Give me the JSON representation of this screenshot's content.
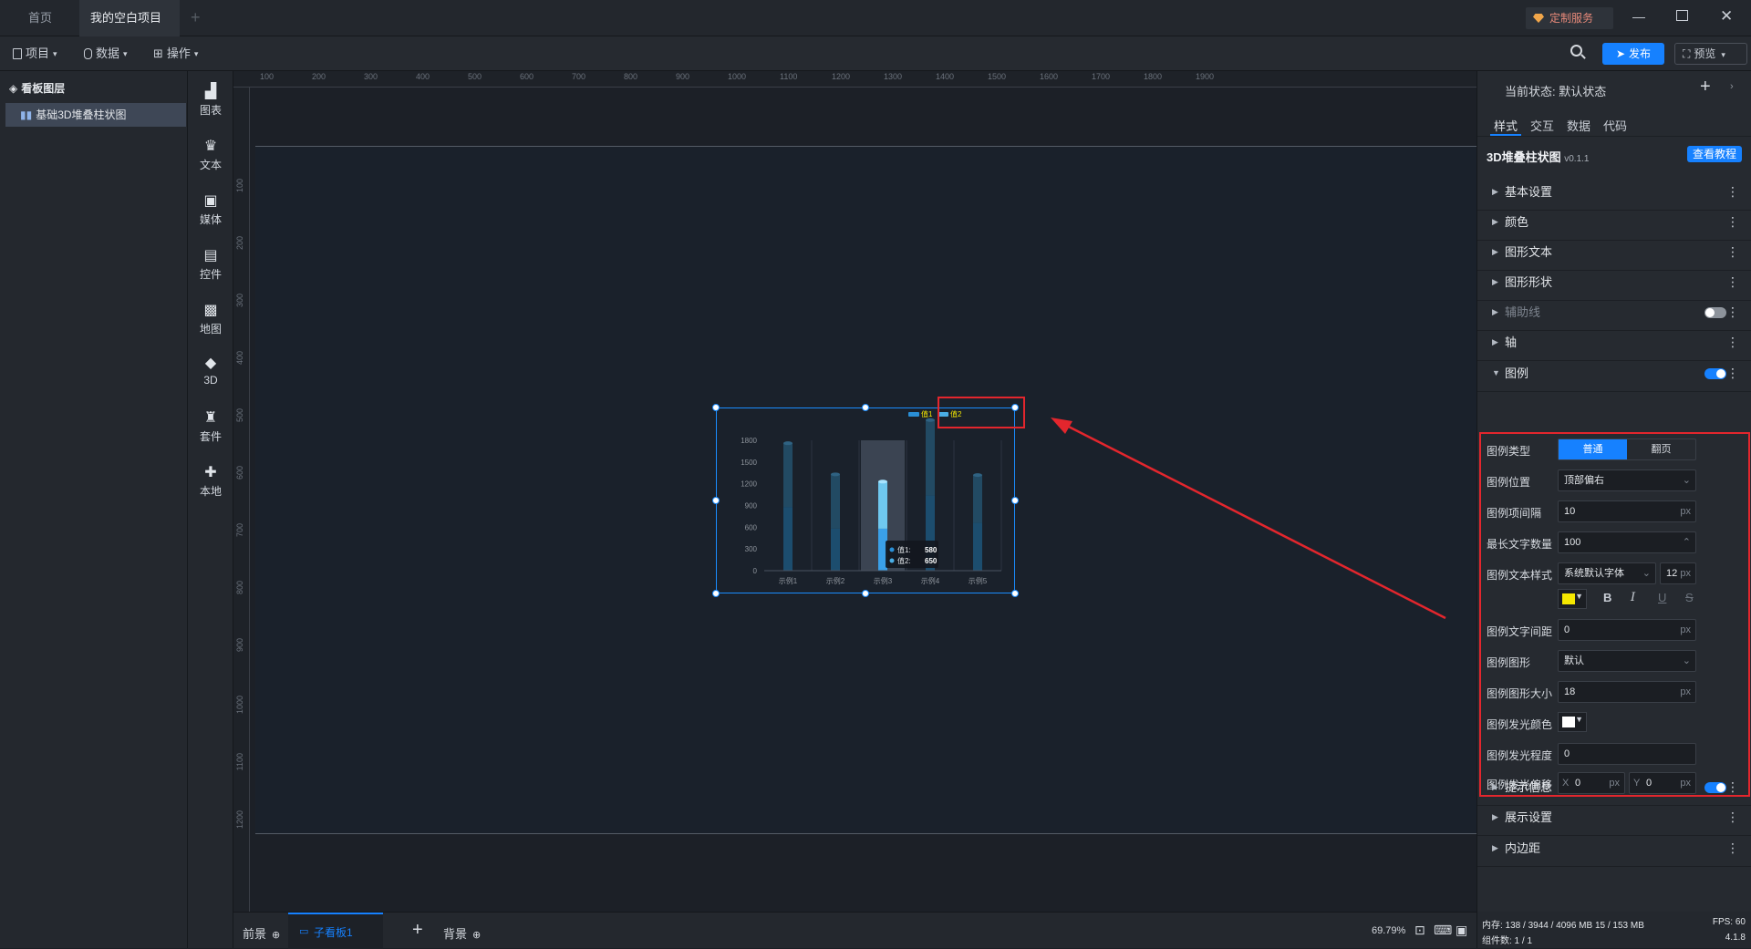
{
  "tabs": [
    {
      "label": "首页"
    },
    {
      "label": "我的空白项目"
    }
  ],
  "titlebar": {
    "service_label": "定制服务"
  },
  "menubar": {
    "project": "项目",
    "data": "数据",
    "operation": "操作",
    "publish": "发布",
    "preview": "预览"
  },
  "layers": {
    "title": "看板图层",
    "items": [
      {
        "label": "基础3D堆叠柱状图"
      }
    ]
  },
  "tools": [
    {
      "label": "图表",
      "icon": "bar-chart-icon"
    },
    {
      "label": "文本",
      "icon": "text-icon"
    },
    {
      "label": "媒体",
      "icon": "media-icon"
    },
    {
      "label": "控件",
      "icon": "widget-icon"
    },
    {
      "label": "地图",
      "icon": "map-icon"
    },
    {
      "label": "3D",
      "icon": "cube-icon"
    },
    {
      "label": "套件",
      "icon": "kit-icon"
    },
    {
      "label": "本地",
      "icon": "puzzle-icon"
    }
  ],
  "ruler": {
    "h": [
      "100",
      "200",
      "300",
      "400",
      "500",
      "600",
      "700",
      "800",
      "900",
      "1000",
      "1100",
      "1200",
      "1300",
      "1400",
      "1500",
      "1600",
      "1700",
      "1800",
      "1900"
    ],
    "v": [
      "100",
      "200",
      "300",
      "400",
      "500",
      "600",
      "700",
      "800",
      "900",
      "1000",
      "1100",
      "1200"
    ]
  },
  "chart_data": {
    "type": "bar",
    "stacked": true,
    "categories": [
      "示例1",
      "示例2",
      "示例3",
      "示例4",
      "示例5"
    ],
    "series": [
      {
        "name": "值1",
        "values": [
          880,
          580,
          580,
          1040,
          660
        ]
      },
      {
        "name": "值2",
        "values": [
          880,
          750,
          650,
          1040,
          660
        ]
      }
    ],
    "ylim": [
      0,
      1800
    ],
    "yticks": [
      "0",
      "300",
      "600",
      "900",
      "1200",
      "1500",
      "1800"
    ],
    "legend_position": "top-right",
    "highlight_index": 2,
    "tooltip": {
      "rows": [
        {
          "name": "值1:",
          "value": "580"
        },
        {
          "name": "值2:",
          "value": "650"
        }
      ]
    }
  },
  "panel": {
    "state_label": "当前状态:",
    "state_value": "默认状态",
    "tabs": [
      "样式",
      "交互",
      "数据",
      "代码"
    ],
    "component_title": "3D堆叠柱状图",
    "version": "v0.1.1",
    "tutorial": "查看教程",
    "sections_top": [
      "基本设置",
      "颜色",
      "图形文本",
      "图形形状",
      "辅助线",
      "轴",
      "图例"
    ],
    "legend": {
      "type_label": "图例类型",
      "type_options": [
        "普通",
        "翻页"
      ],
      "position_label": "图例位置",
      "position_value": "顶部偏右",
      "gap_label": "图例项间隔",
      "gap_value": "10",
      "maxchars_label": "最长文字数量",
      "maxchars_value": "100",
      "textstyle_label": "图例文本样式",
      "font_value": "系统默认字体",
      "fontsize_value": "12",
      "textcolor": "#f5e800",
      "spacing_label": "图例文字间距",
      "spacing_value": "0",
      "shape_label": "图例图形",
      "shape_value": "默认",
      "shapesize_label": "图例图形大小",
      "shapesize_value": "18",
      "glowcolor_label": "图例发光颜色",
      "glowcolor": "#ffffff",
      "glowlevel_label": "图例发光程度",
      "glowlevel_value": "0",
      "glowoffset_label": "图例发光偏移",
      "x_label": "X",
      "x_value": "0",
      "y_label": "Y",
      "y_value": "0",
      "unit": "px"
    },
    "sections_bottom": [
      "提示信息",
      "展示设置",
      "内边距"
    ]
  },
  "status": {
    "foreground": "前景",
    "subboard": "子看板1",
    "background": "背景",
    "zoom": "69.79%",
    "memory": "内存: 138 / 3944 / 4096 MB  15 / 153 MB",
    "fps": "FPS: 60",
    "components": "组件数: 1 / 1",
    "version": "4.1.8"
  },
  "colors": {
    "accent": "#1681ff",
    "highlight_red": "#e3262d",
    "selection_blue": "#1a8cff"
  }
}
